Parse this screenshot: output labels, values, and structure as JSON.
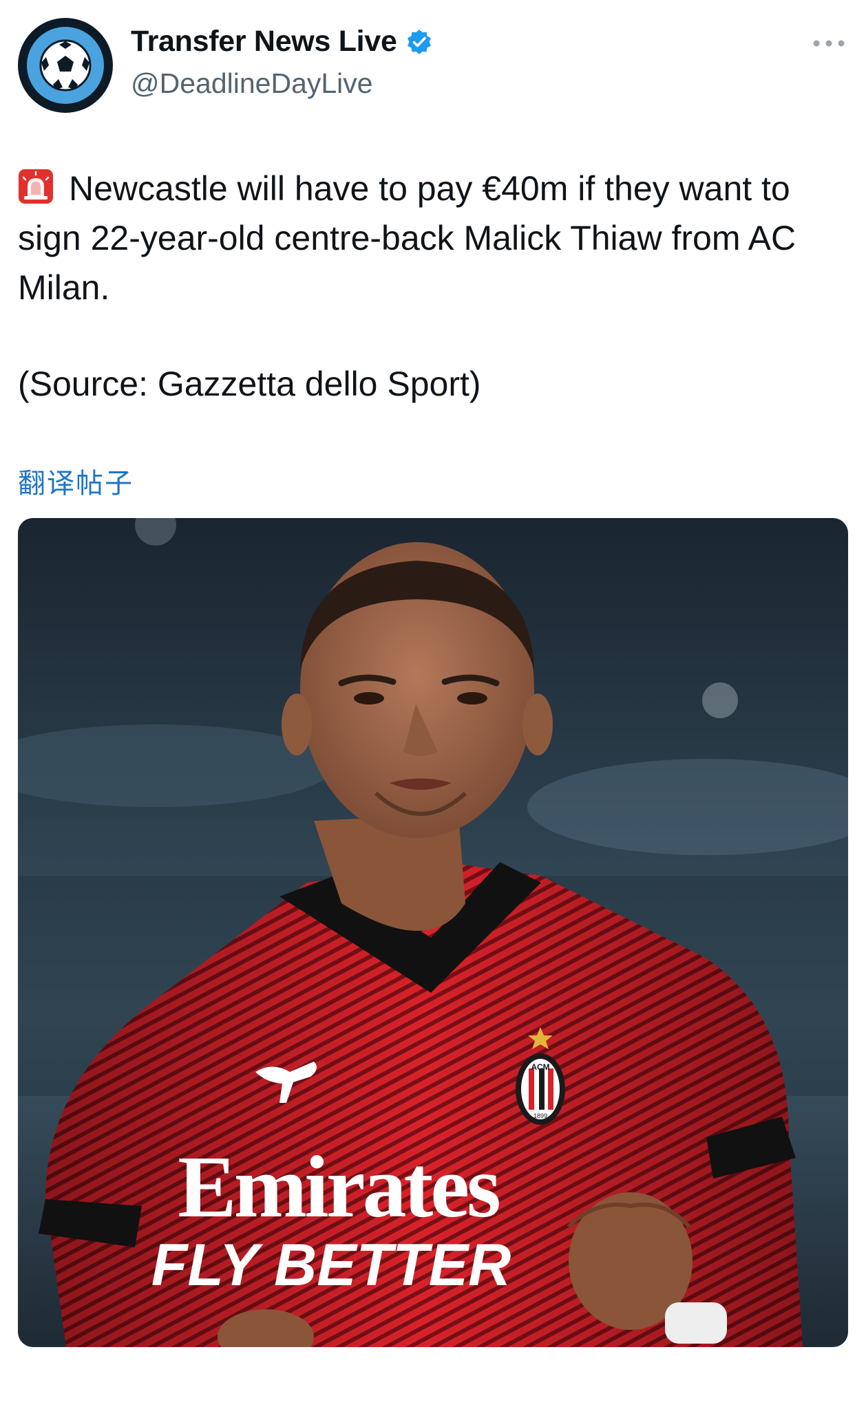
{
  "author": {
    "name": "Transfer News Live",
    "handle": "@DeadlineDayLive",
    "avatar_icon": "football-icon",
    "verified_icon": "verified-badge-icon",
    "verified_color": "#1d9bf0"
  },
  "tweet": {
    "siren_icon": "rotating-light-icon",
    "body": "Newcastle will have to pay €40m if they want to sign 22-year-old centre-back Malick Thiaw from AC Milan.",
    "source": "(Source: Gazzetta dello Sport)"
  },
  "translate_label": "翻译帖子",
  "more_icon": "more-options-icon",
  "media": {
    "shirt_sponsor": "Emirates",
    "shirt_slogan": "FLY BETTER",
    "crest_text": "ACM",
    "crest_year": "1899",
    "shirt_color": "#d8222a"
  }
}
